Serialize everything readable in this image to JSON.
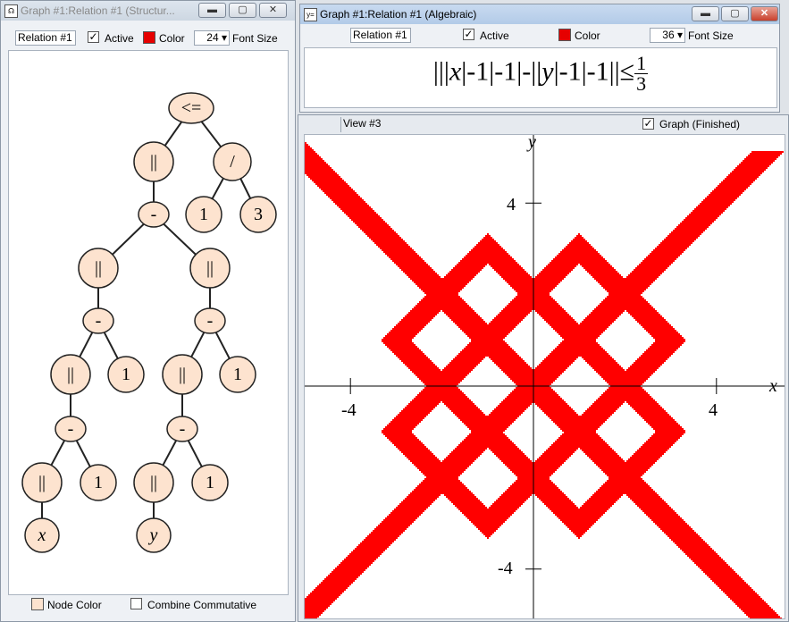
{
  "left_window": {
    "title": "Graph #1:Relation #1 (Structur...",
    "relation_name": "Relation #1",
    "active_label": "Active",
    "active_checked": "✓",
    "color_label": "Color",
    "font_size_value": "24",
    "font_size_label": "Font Size",
    "node_color_label": "Node Color",
    "combine_label": "Combine Commutative",
    "tree": {
      "root": "<=",
      "abs": "||",
      "divide": "/",
      "minus": "-",
      "one": "1",
      "three": "3",
      "x": "x",
      "y": "y"
    }
  },
  "right_window": {
    "title": "Graph #1:Relation #1 (Algebraic)",
    "relation_name": "Relation #1",
    "active_label": "Active",
    "active_checked": "✓",
    "color_label": "Color",
    "font_size_value": "36",
    "font_size_label": "Font Size",
    "formula": {
      "left_bars": "|||",
      "var_x": "x",
      "part1": "|-1|-1|-||",
      "var_y": "y",
      "part2": "|-1|-1||≤",
      "numerator": "1",
      "denominator": "3"
    },
    "view_label": "View #3",
    "graph_checked": "✓",
    "graph_label": "Graph (Finished)",
    "axes": {
      "x_label": "x",
      "y_label": "y",
      "tick_pos": "4",
      "tick_neg": "-4"
    }
  },
  "chart_data": {
    "type": "region",
    "relation": "||||x|-1|-1|-|||y|-1|-1|| <= 1/3",
    "xlim": [
      -6,
      6
    ],
    "ylim": [
      -6,
      6
    ],
    "x_ticks": [
      -4,
      4
    ],
    "y_ticks": [
      -4,
      4
    ],
    "fill_color": "#ff0000",
    "grid": false
  },
  "colors": {
    "relation_color": "#e60000",
    "node_fill": "#fde3cf"
  }
}
